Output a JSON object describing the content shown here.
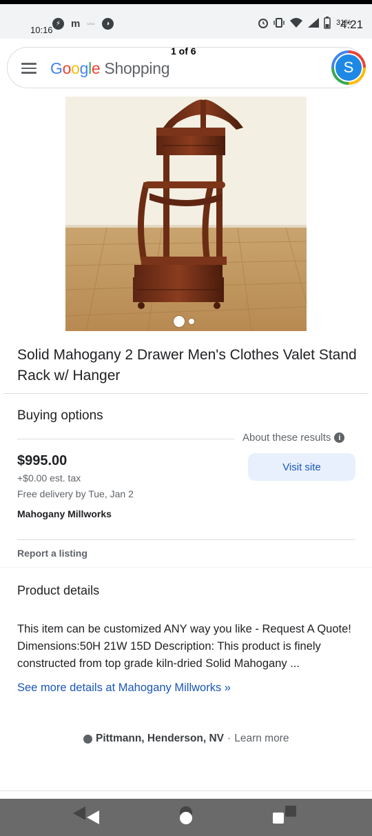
{
  "status_bar": {
    "time_left": "10:16",
    "battery": "31%",
    "time_right": "4:21",
    "left_icons": [
      "messenger-icon",
      "m-app-icon",
      "tiny-text-icon",
      "game-icon"
    ],
    "right_icons": [
      "alarm-icon",
      "vibrate-icon",
      "wifi-icon",
      "signal-icon",
      "battery-icon"
    ]
  },
  "header": {
    "logo_google": [
      "G",
      "o",
      "o",
      "g",
      "l",
      "e"
    ],
    "logo_suffix": "Shopping",
    "pager": "1 of 6",
    "avatar_initial": "S",
    "brand_colors": {
      "blue": "#4285f4",
      "red": "#ea4335",
      "yellow": "#fbbc05",
      "green": "#34a853"
    }
  },
  "product": {
    "title": "Solid Mahogany 2 Drawer Men's Clothes Valet Stand Rack w/ Hanger",
    "image_count_active": 1
  },
  "buying_options": {
    "heading": "Buying options",
    "about_label": "About these results",
    "price": "$995.00",
    "tax": "+$0.00 est. tax",
    "delivery": "Free delivery by Tue, Jan 2",
    "merchant": "Mahogany Millworks",
    "visit_label": "Visit site",
    "report_label": "Report a listing"
  },
  "product_details": {
    "heading": "Product details",
    "description": "This item can be customized ANY way you like - Request A Quote! Dimensions:50H 21W 15D Description: This product is finely constructed from top grade kiln-dried Solid Mahogany ...",
    "see_more": "See more details at Mahogany Millworks »"
  },
  "footer": {
    "location": "Pittmann, Henderson, NV",
    "separator": "·",
    "learn_more": "Learn more"
  },
  "nav": {
    "buttons": [
      "back-button",
      "home-button",
      "recents-button"
    ]
  }
}
